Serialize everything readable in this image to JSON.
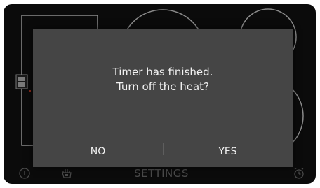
{
  "dialog": {
    "message_line1": "Timer has finished.",
    "message_line2": "Turn off the heat?",
    "no_label": "NO",
    "yes_label": "YES"
  },
  "bottom_bar": {
    "settings_label": "SETTINGS",
    "icons": [
      "power-icon",
      "child-lock-icon",
      "alarm-clock-icon"
    ]
  },
  "colors": {
    "screen_background": "#0b0b0b",
    "dialog_background": "#454545",
    "dialog_text": "#f2f2f2",
    "dimmed_ui": "#4a4a4a",
    "indicator_red": "#8a2a1a"
  }
}
